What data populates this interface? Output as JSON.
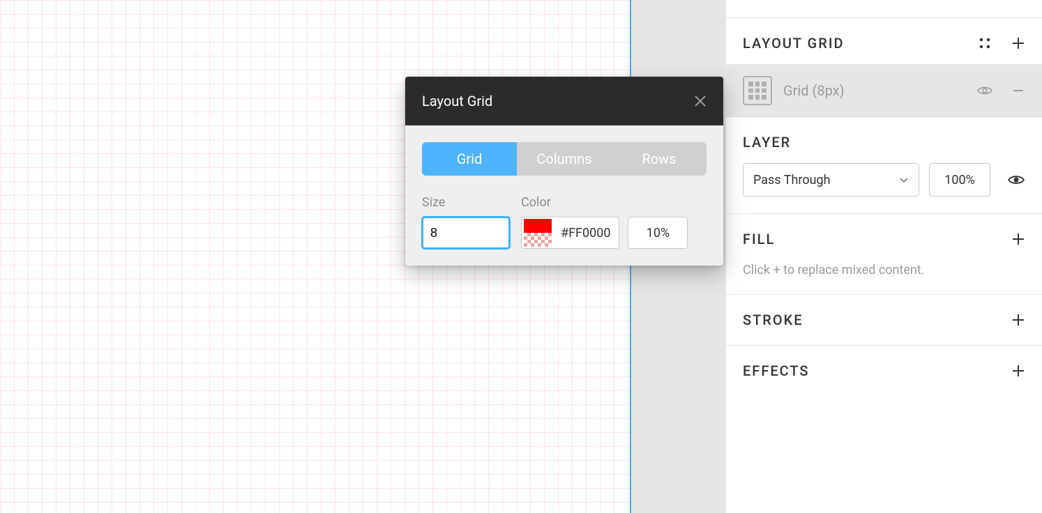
{
  "popover": {
    "title": "Layout Grid",
    "tabs": {
      "grid": "Grid",
      "columns": "Columns",
      "rows": "Rows"
    },
    "size_label": "Size",
    "size_value": "8",
    "color_label": "Color",
    "color_hex": "#FF0000",
    "opacity": "10%"
  },
  "panel": {
    "layout_grid": {
      "title": "LAYOUT GRID",
      "entry_label": "Grid (8px)"
    },
    "layer": {
      "title": "LAYER",
      "blend_mode": "Pass Through",
      "opacity": "100%"
    },
    "fill": {
      "title": "FILL",
      "help": "Click + to replace mixed content."
    },
    "stroke": {
      "title": "STROKE"
    },
    "effects": {
      "title": "EFFECTS"
    }
  }
}
